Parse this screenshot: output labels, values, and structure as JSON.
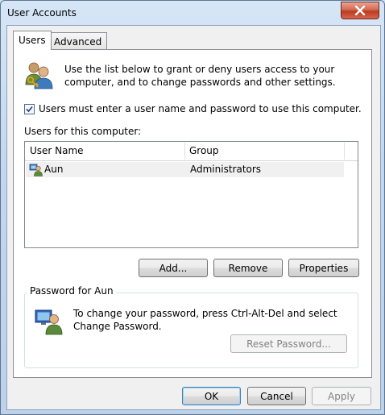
{
  "window": {
    "title": "User Accounts",
    "close_icon": "close-x-icon"
  },
  "tabs": [
    {
      "label": "Users",
      "active": true
    },
    {
      "label": "Advanced",
      "active": false
    }
  ],
  "users_tab": {
    "intro": "Use the list below to grant or deny users access to your computer, and to change passwords and other settings.",
    "require_login": {
      "label": "Users must enter a user name and password to use this computer.",
      "checked": true
    },
    "list_label": "Users for this computer:",
    "columns": [
      "User Name",
      "Group"
    ],
    "rows": [
      {
        "user_name": "Aun",
        "group": "Administrators"
      }
    ],
    "buttons": {
      "add": "Add...",
      "remove": "Remove",
      "properties": "Properties"
    },
    "password_group": {
      "title": "Password for Aun",
      "text": "To change your password, press Ctrl-Alt-Del and select Change Password.",
      "reset_button": "Reset Password..."
    }
  },
  "dialog_buttons": {
    "ok": "OK",
    "cancel": "Cancel",
    "apply": "Apply"
  },
  "colors": {
    "frame": "#c3d7ee",
    "close": "#c8472e",
    "selection_row": "#f0f0f0",
    "default_button_border": "#3c7fb1"
  }
}
